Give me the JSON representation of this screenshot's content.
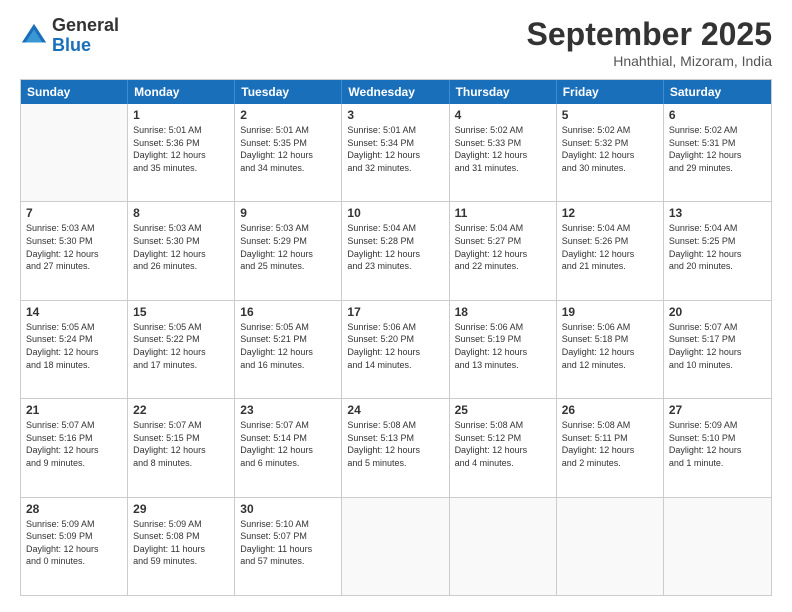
{
  "logo": {
    "general": "General",
    "blue": "Blue"
  },
  "header": {
    "title": "September 2025",
    "subtitle": "Hnahthial, Mizoram, India"
  },
  "days": [
    "Sunday",
    "Monday",
    "Tuesday",
    "Wednesday",
    "Thursday",
    "Friday",
    "Saturday"
  ],
  "weeks": [
    [
      {
        "day": "",
        "info": ""
      },
      {
        "day": "1",
        "info": "Sunrise: 5:01 AM\nSunset: 5:36 PM\nDaylight: 12 hours\nand 35 minutes."
      },
      {
        "day": "2",
        "info": "Sunrise: 5:01 AM\nSunset: 5:35 PM\nDaylight: 12 hours\nand 34 minutes."
      },
      {
        "day": "3",
        "info": "Sunrise: 5:01 AM\nSunset: 5:34 PM\nDaylight: 12 hours\nand 32 minutes."
      },
      {
        "day": "4",
        "info": "Sunrise: 5:02 AM\nSunset: 5:33 PM\nDaylight: 12 hours\nand 31 minutes."
      },
      {
        "day": "5",
        "info": "Sunrise: 5:02 AM\nSunset: 5:32 PM\nDaylight: 12 hours\nand 30 minutes."
      },
      {
        "day": "6",
        "info": "Sunrise: 5:02 AM\nSunset: 5:31 PM\nDaylight: 12 hours\nand 29 minutes."
      }
    ],
    [
      {
        "day": "7",
        "info": "Sunrise: 5:03 AM\nSunset: 5:30 PM\nDaylight: 12 hours\nand 27 minutes."
      },
      {
        "day": "8",
        "info": "Sunrise: 5:03 AM\nSunset: 5:30 PM\nDaylight: 12 hours\nand 26 minutes."
      },
      {
        "day": "9",
        "info": "Sunrise: 5:03 AM\nSunset: 5:29 PM\nDaylight: 12 hours\nand 25 minutes."
      },
      {
        "day": "10",
        "info": "Sunrise: 5:04 AM\nSunset: 5:28 PM\nDaylight: 12 hours\nand 23 minutes."
      },
      {
        "day": "11",
        "info": "Sunrise: 5:04 AM\nSunset: 5:27 PM\nDaylight: 12 hours\nand 22 minutes."
      },
      {
        "day": "12",
        "info": "Sunrise: 5:04 AM\nSunset: 5:26 PM\nDaylight: 12 hours\nand 21 minutes."
      },
      {
        "day": "13",
        "info": "Sunrise: 5:04 AM\nSunset: 5:25 PM\nDaylight: 12 hours\nand 20 minutes."
      }
    ],
    [
      {
        "day": "14",
        "info": "Sunrise: 5:05 AM\nSunset: 5:24 PM\nDaylight: 12 hours\nand 18 minutes."
      },
      {
        "day": "15",
        "info": "Sunrise: 5:05 AM\nSunset: 5:22 PM\nDaylight: 12 hours\nand 17 minutes."
      },
      {
        "day": "16",
        "info": "Sunrise: 5:05 AM\nSunset: 5:21 PM\nDaylight: 12 hours\nand 16 minutes."
      },
      {
        "day": "17",
        "info": "Sunrise: 5:06 AM\nSunset: 5:20 PM\nDaylight: 12 hours\nand 14 minutes."
      },
      {
        "day": "18",
        "info": "Sunrise: 5:06 AM\nSunset: 5:19 PM\nDaylight: 12 hours\nand 13 minutes."
      },
      {
        "day": "19",
        "info": "Sunrise: 5:06 AM\nSunset: 5:18 PM\nDaylight: 12 hours\nand 12 minutes."
      },
      {
        "day": "20",
        "info": "Sunrise: 5:07 AM\nSunset: 5:17 PM\nDaylight: 12 hours\nand 10 minutes."
      }
    ],
    [
      {
        "day": "21",
        "info": "Sunrise: 5:07 AM\nSunset: 5:16 PM\nDaylight: 12 hours\nand 9 minutes."
      },
      {
        "day": "22",
        "info": "Sunrise: 5:07 AM\nSunset: 5:15 PM\nDaylight: 12 hours\nand 8 minutes."
      },
      {
        "day": "23",
        "info": "Sunrise: 5:07 AM\nSunset: 5:14 PM\nDaylight: 12 hours\nand 6 minutes."
      },
      {
        "day": "24",
        "info": "Sunrise: 5:08 AM\nSunset: 5:13 PM\nDaylight: 12 hours\nand 5 minutes."
      },
      {
        "day": "25",
        "info": "Sunrise: 5:08 AM\nSunset: 5:12 PM\nDaylight: 12 hours\nand 4 minutes."
      },
      {
        "day": "26",
        "info": "Sunrise: 5:08 AM\nSunset: 5:11 PM\nDaylight: 12 hours\nand 2 minutes."
      },
      {
        "day": "27",
        "info": "Sunrise: 5:09 AM\nSunset: 5:10 PM\nDaylight: 12 hours\nand 1 minute."
      }
    ],
    [
      {
        "day": "28",
        "info": "Sunrise: 5:09 AM\nSunset: 5:09 PM\nDaylight: 12 hours\nand 0 minutes."
      },
      {
        "day": "29",
        "info": "Sunrise: 5:09 AM\nSunset: 5:08 PM\nDaylight: 11 hours\nand 59 minutes."
      },
      {
        "day": "30",
        "info": "Sunrise: 5:10 AM\nSunset: 5:07 PM\nDaylight: 11 hours\nand 57 minutes."
      },
      {
        "day": "",
        "info": ""
      },
      {
        "day": "",
        "info": ""
      },
      {
        "day": "",
        "info": ""
      },
      {
        "day": "",
        "info": ""
      }
    ]
  ]
}
